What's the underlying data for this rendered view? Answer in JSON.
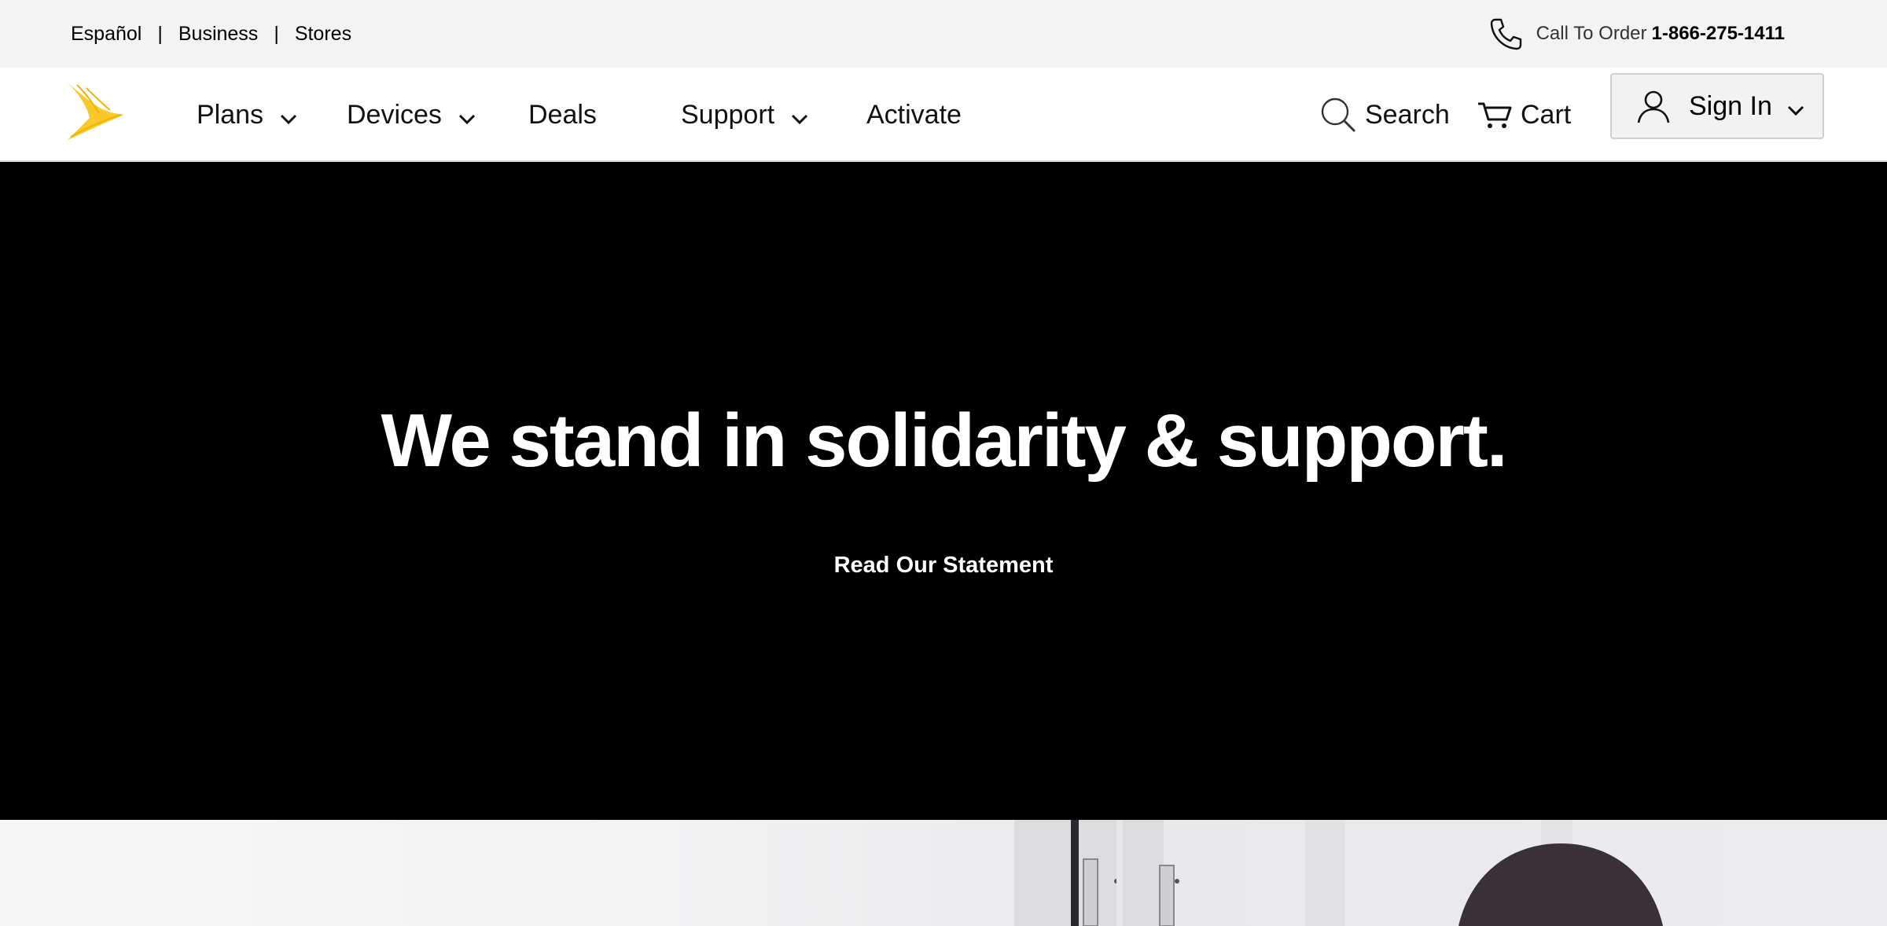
{
  "utility_bar": {
    "links": [
      "Español",
      "Business",
      "Stores"
    ],
    "separator": "|",
    "call_label": "Call To Order",
    "phone_number": "1-866-275-1411",
    "phone_icon": "phone-icon"
  },
  "nav": {
    "logo_icon": "sprint-logo",
    "items": [
      {
        "label": "Plans",
        "has_dropdown": true
      },
      {
        "label": "Devices",
        "has_dropdown": true
      },
      {
        "label": "Deals",
        "has_dropdown": false
      },
      {
        "label": "Support",
        "has_dropdown": true
      },
      {
        "label": "Activate",
        "has_dropdown": false
      }
    ],
    "search_label": "Search",
    "cart_label": "Cart",
    "signin_label": "Sign In"
  },
  "hero": {
    "title": "We stand in solidarity & support.",
    "link_label": "Read Our Statement"
  },
  "colors": {
    "utility_bg": "#f3f3f3",
    "hero_bg": "#000000",
    "logo_yellow": "#f8c92a"
  }
}
